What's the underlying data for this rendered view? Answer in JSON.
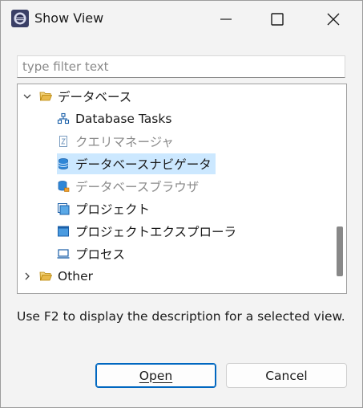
{
  "window": {
    "title": "Show View",
    "icon": "eclipse-app-icon",
    "controls": [
      "minimize-icon",
      "maximize-icon",
      "close-icon"
    ]
  },
  "filter": {
    "placeholder": "type filter text",
    "value": ""
  },
  "tree": {
    "items": [
      {
        "label": "データベース",
        "icon": "folder-icon",
        "expanded": true,
        "level": 0
      },
      {
        "label": "Database Tasks",
        "icon": "db-tasks-icon",
        "level": 1
      },
      {
        "label": "クエリマネージャ",
        "icon": "query-manager-icon",
        "level": 1
      },
      {
        "label": "データベースナビゲータ",
        "icon": "database-icon",
        "level": 1,
        "selected": true
      },
      {
        "label": "データベースブラウザ",
        "icon": "database-browser-icon",
        "level": 1
      },
      {
        "label": "プロジェクト",
        "icon": "project-icon",
        "level": 1
      },
      {
        "label": "プロジェクトエクスプローラ",
        "icon": "project-explorer-icon",
        "level": 1
      },
      {
        "label": "プロセス",
        "icon": "process-icon",
        "level": 1
      },
      {
        "label": "Other",
        "icon": "folder-icon",
        "expanded": false,
        "level": 0
      }
    ]
  },
  "description": "Use F2 to display the description for a selected view.",
  "buttons": {
    "open": "Open",
    "cancel": "Cancel"
  },
  "colors": {
    "selection": "#cce8ff",
    "accent": "#0067c0",
    "folder": "#e8b94a"
  }
}
